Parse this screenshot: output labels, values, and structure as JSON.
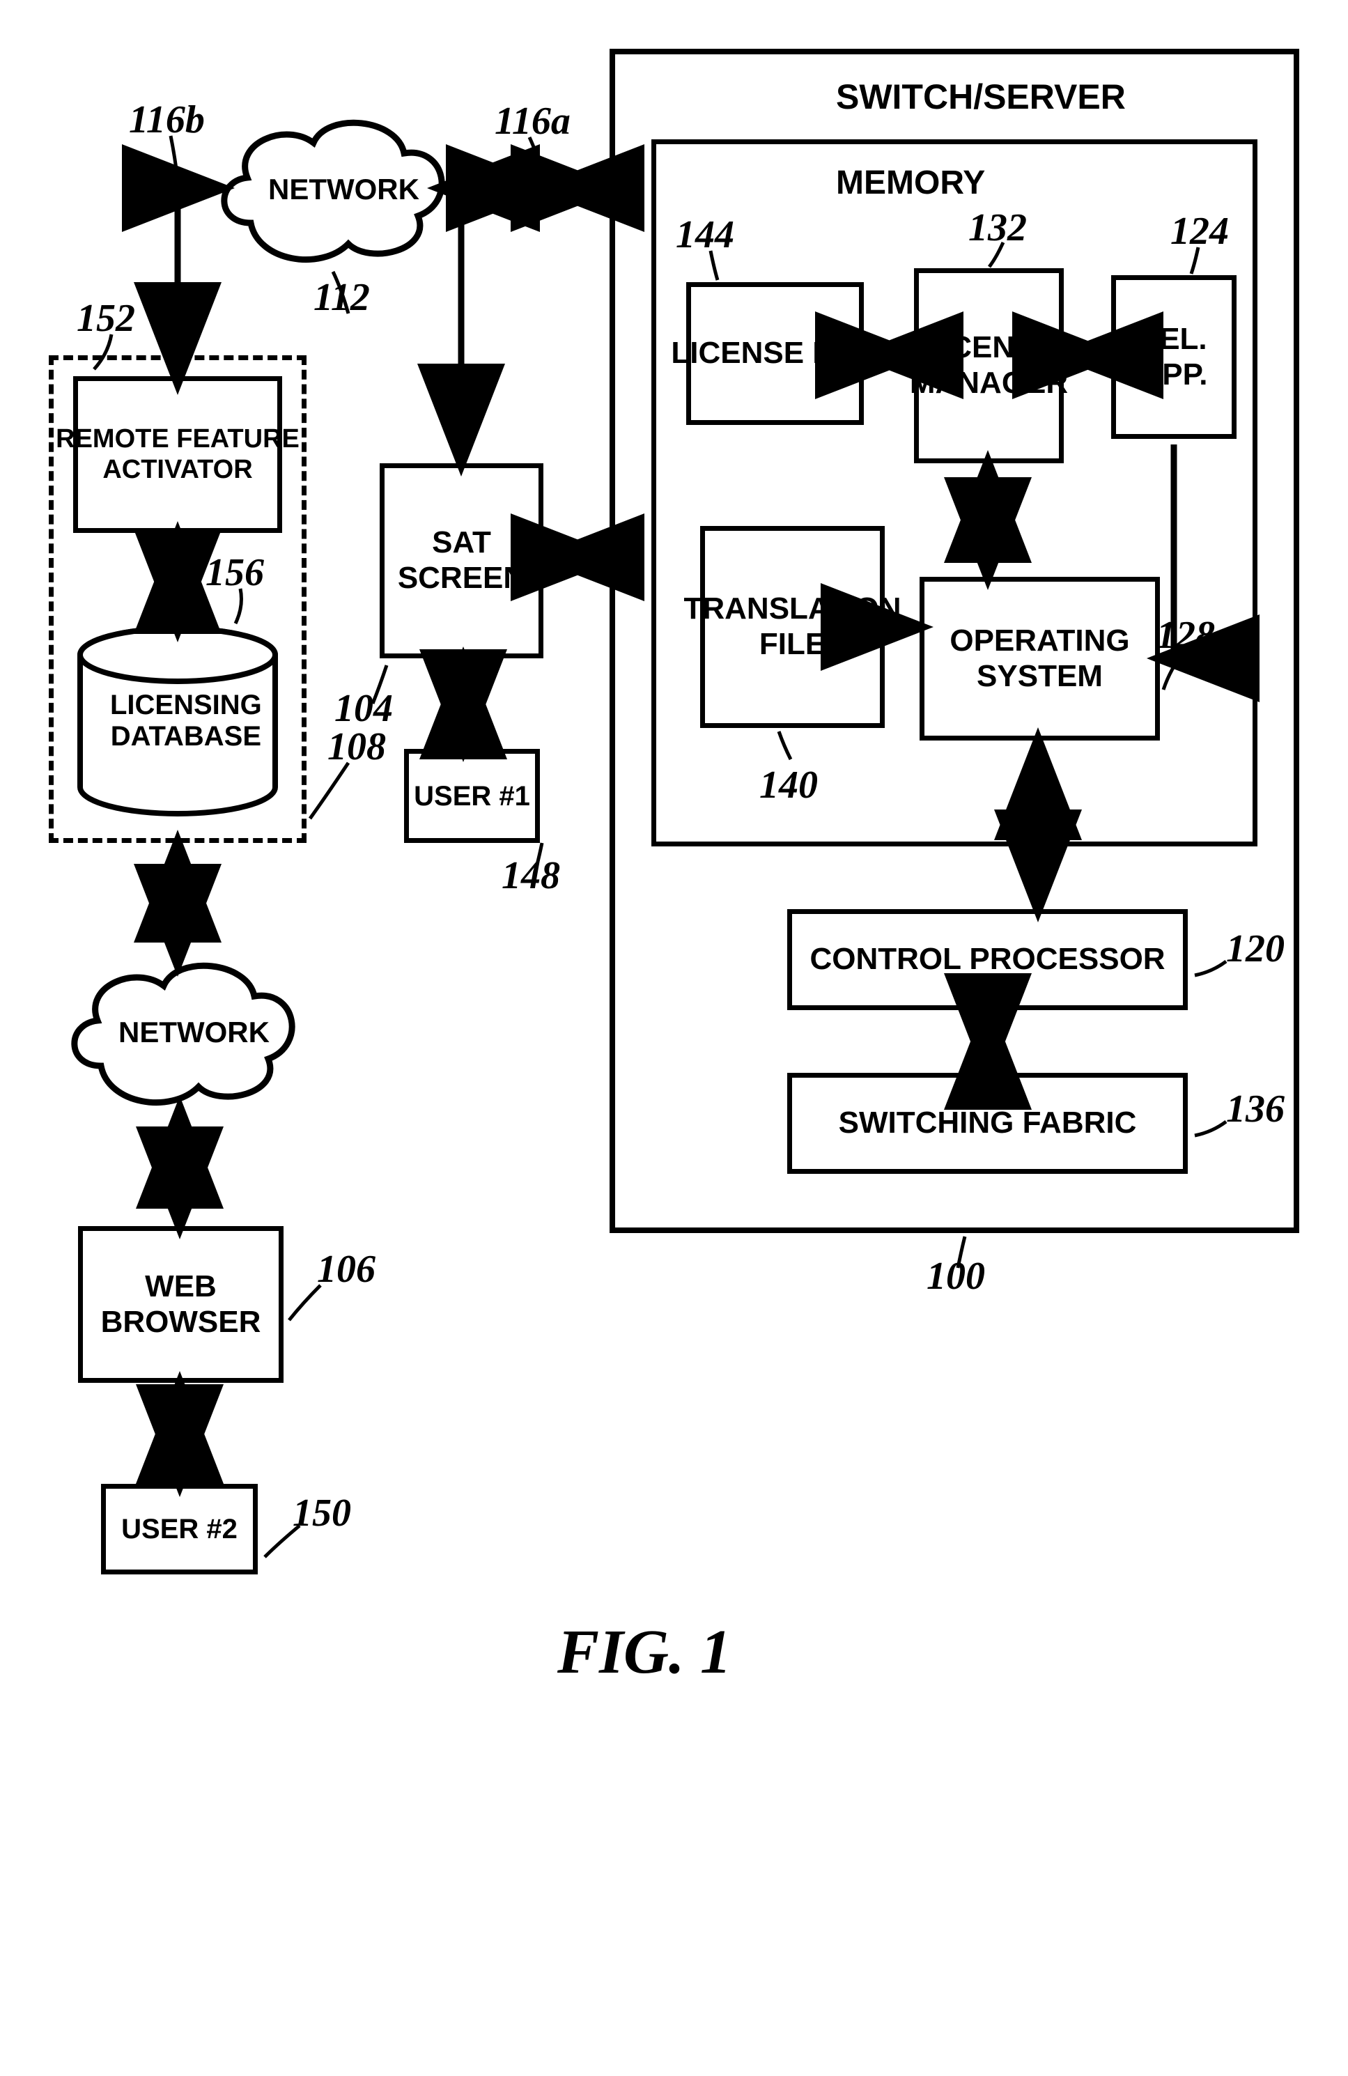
{
  "figure_label": "FIG. 1",
  "switchserver": {
    "title": "SWITCH/SERVER",
    "memory": "MEMORY",
    "license_file": "LICENSE FILE",
    "license_manager": "LICENSE\nMANAGER",
    "tel_app": "TEL. APP.",
    "translation_file": "TRANSLATION\nFILE",
    "operating_system": "OPERATING\nSYSTEM",
    "control_processor": "CONTROL PROCESSOR",
    "switching_fabric": "SWITCHING FABRIC"
  },
  "sat_screen": "SAT\nSCREEN",
  "user1": "USER #1",
  "network1": "NETWORK",
  "remote_feature_activator": "REMOTE FEATURE\nACTIVATOR",
  "licensing_database": "LICENSING\nDATABASE",
  "network2": "NETWORK",
  "web_browser": "WEB\nBROWSER",
  "user2": "USER #2",
  "refs": {
    "r100": "100",
    "r104": "104",
    "r106": "106",
    "r108": "108",
    "r112": "112",
    "r116a": "116a",
    "r116b": "116b",
    "r120": "120",
    "r124": "124",
    "r128": "128",
    "r132": "132",
    "r136": "136",
    "r140": "140",
    "r144": "144",
    "r148": "148",
    "r150": "150",
    "r152": "152",
    "r156": "156"
  }
}
